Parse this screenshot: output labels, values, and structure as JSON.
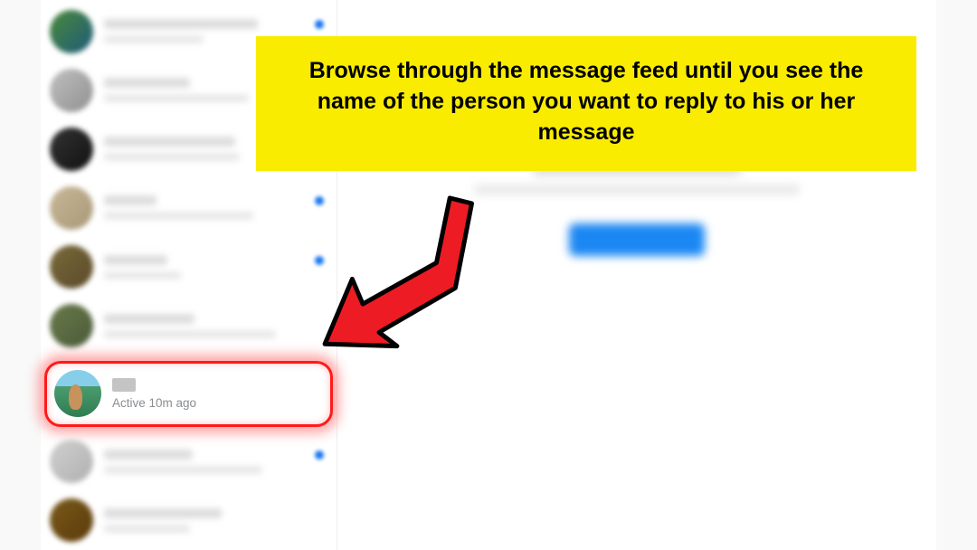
{
  "callout_text": "Browse through the message feed until you see the name of the person you want to reply to his or her message",
  "highlighted_chat": {
    "status": "Active 10m ago"
  },
  "sidebar": {
    "items_before": [
      {
        "avatar_gradient": [
          "#4a8a3a",
          "#1e5a7a"
        ],
        "name_w": 170,
        "preview_w": 110,
        "unread": true
      },
      {
        "avatar_gradient": [
          "#c0c0c0",
          "#909090"
        ],
        "name_w": 95,
        "preview_w": 160,
        "unread": false
      },
      {
        "avatar_gradient": [
          "#333",
          "#111"
        ],
        "name_w": 145,
        "preview_w": 150,
        "unread": false
      },
      {
        "avatar_gradient": [
          "#c8b898",
          "#a89878"
        ],
        "name_w": 58,
        "preview_w": 165,
        "unread": true
      },
      {
        "avatar_gradient": [
          "#7a6a3a",
          "#5a4a2a"
        ],
        "name_w": 70,
        "preview_w": 85,
        "unread": true
      },
      {
        "avatar_gradient": [
          "#6a7a4a",
          "#4a5a3a"
        ],
        "name_w": 100,
        "preview_w": 190,
        "unread": false
      }
    ],
    "items_after": [
      {
        "avatar_gradient": [
          "#d0d0d0",
          "#b0b0b0"
        ],
        "name_w": 98,
        "preview_w": 175,
        "unread": true
      },
      {
        "avatar_gradient": [
          "#7a5a1a",
          "#5a3a0a"
        ],
        "name_w": 130,
        "preview_w": 95,
        "unread": false
      }
    ]
  }
}
